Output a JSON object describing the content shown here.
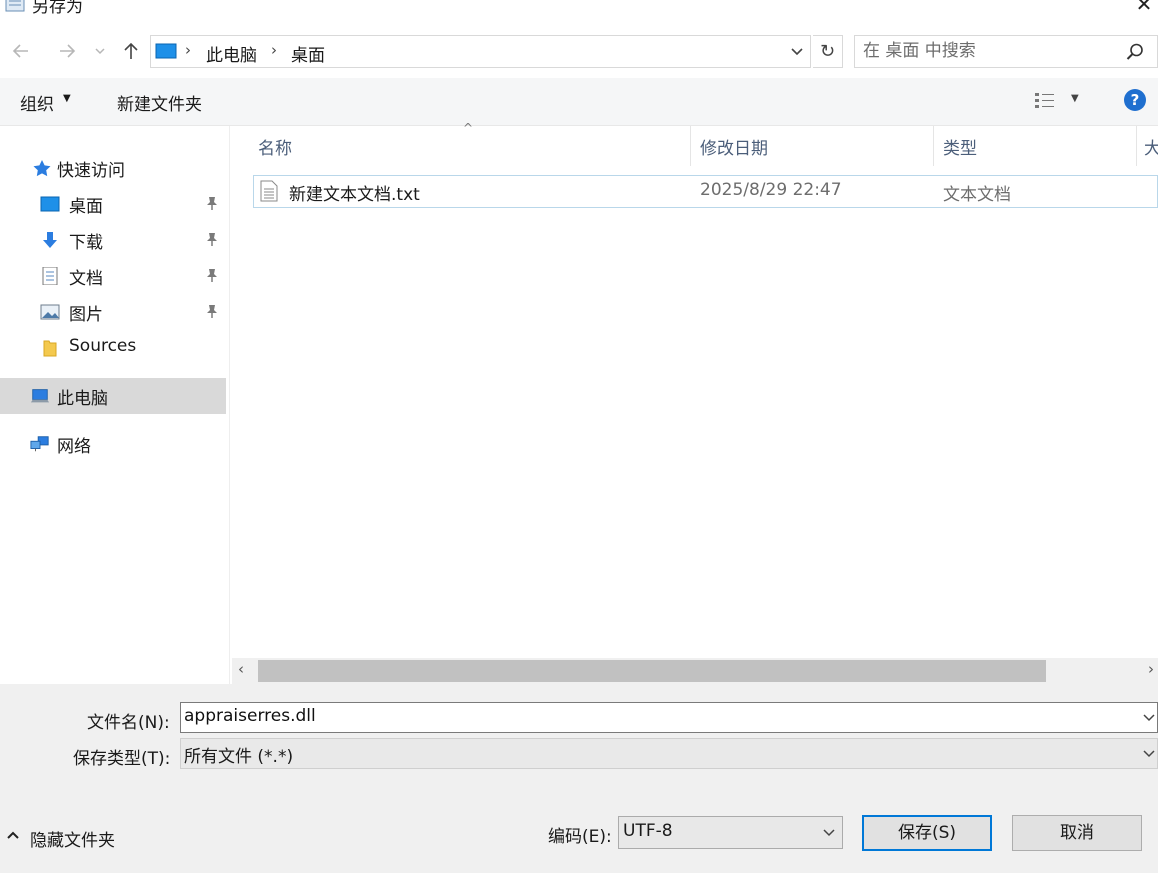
{
  "window": {
    "title": "另存为",
    "close_glyph": "✕"
  },
  "address": {
    "crumbs": [
      "此电脑",
      "桌面"
    ],
    "search_placeholder": "在 桌面 中搜索"
  },
  "toolbar": {
    "organize": "组织",
    "new_folder": "新建文件夹",
    "help": "?"
  },
  "nav": {
    "quick_access": "快速访问",
    "items": [
      {
        "label": "桌面",
        "icon": "desktop-icon",
        "pinned": true
      },
      {
        "label": "下载",
        "icon": "download-icon",
        "pinned": true
      },
      {
        "label": "文档",
        "icon": "document-icon",
        "pinned": true
      },
      {
        "label": "图片",
        "icon": "picture-icon",
        "pinned": true
      },
      {
        "label": "Sources",
        "icon": "folder-icon",
        "pinned": false
      }
    ],
    "this_pc": "此电脑",
    "network": "网络"
  },
  "columns": [
    "名称",
    "修改日期",
    "类型",
    "大"
  ],
  "files": [
    {
      "name": "新建文本文档.txt",
      "modified": "2025/8/29 22:47",
      "type": "文本文档"
    }
  ],
  "form": {
    "filename_label": "文件名(N):",
    "filename_value": "appraiserres.dll",
    "filetype_label": "保存类型(T):",
    "filetype_value": "所有文件  (*.*)",
    "encoding_label": "编码(E):",
    "encoding_value": "UTF-8",
    "hide_folders": "隐藏文件夹",
    "save": "保存(S)",
    "cancel": "取消"
  },
  "colors": {
    "accent": "#0078d7",
    "help": "#1f6fcf",
    "selected_bg": "#d9d9d9",
    "header_text": "#4b5e7a"
  }
}
